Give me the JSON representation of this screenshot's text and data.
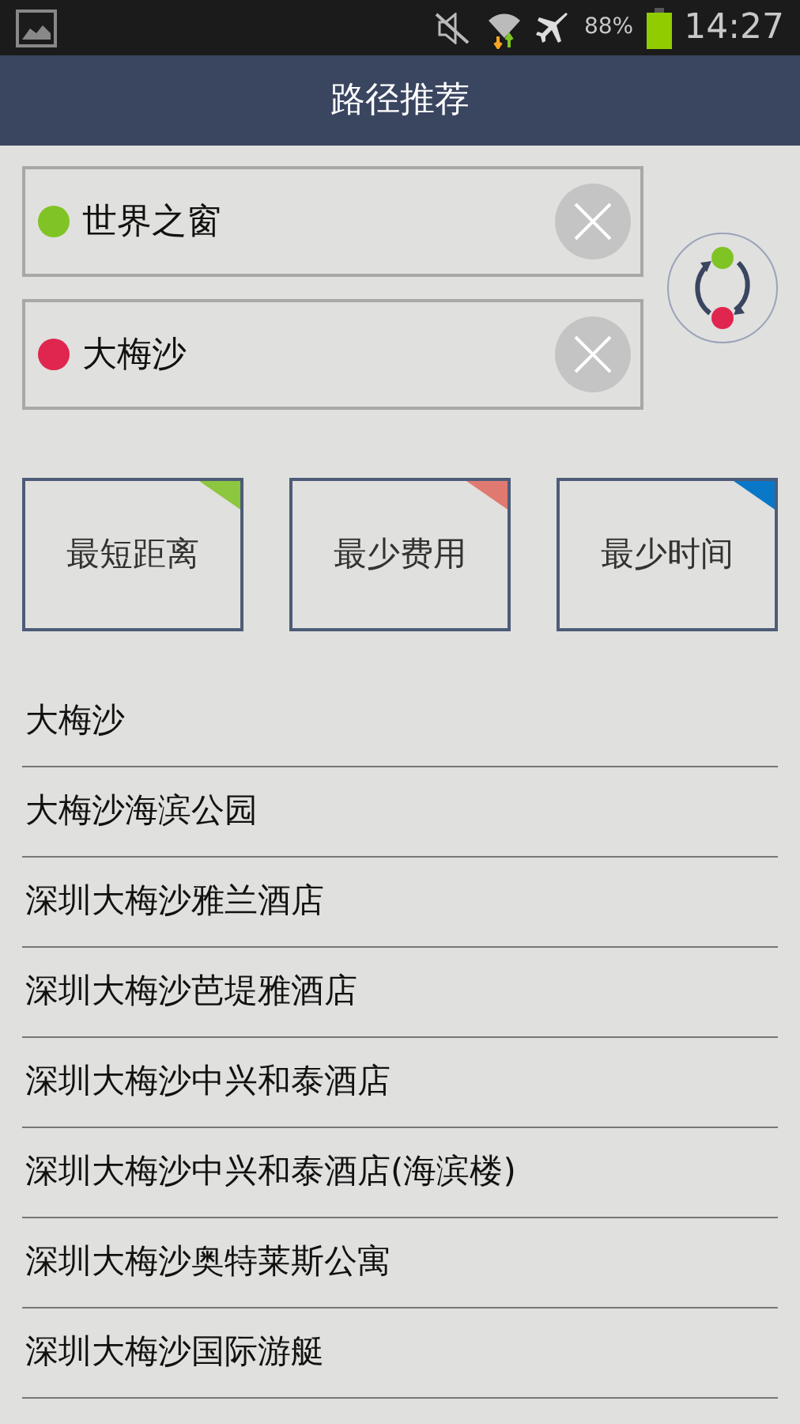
{
  "status_bar": {
    "battery": "88%",
    "time": "14:27"
  },
  "title": "路径推荐",
  "fields": [
    {
      "value": "世界之窗",
      "color": "#7fc424"
    },
    {
      "value": "大梅沙",
      "color": "#e0254f"
    }
  ],
  "options": [
    {
      "label": "最短距离",
      "color": "#8dc63f"
    },
    {
      "label": "最少费用",
      "color": "#e07a70"
    },
    {
      "label": "最少时间",
      "color": "#0a78c8"
    }
  ],
  "suggestions": [
    "大梅沙",
    "大梅沙海滨公园",
    "深圳大梅沙雅兰酒店",
    "深圳大梅沙芭堤雅酒店",
    "深圳大梅沙中兴和泰酒店",
    "深圳大梅沙中兴和泰酒店(海滨楼)",
    "深圳大梅沙奥特莱斯公寓",
    "深圳大梅沙国际游艇"
  ]
}
